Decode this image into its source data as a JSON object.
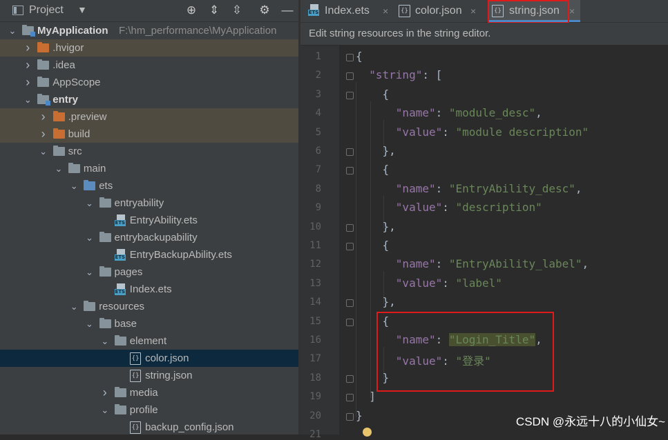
{
  "sidebar": {
    "title": "Project",
    "tree": [
      {
        "label": "MyApplication",
        "path": "F:\\hm_performance\\MyApplication",
        "icon": "module-folder-icon"
      },
      {
        "label": ".hvigor",
        "icon": "excluded-folder-icon"
      },
      {
        "label": ".idea",
        "icon": "folder-icon"
      },
      {
        "label": "AppScope",
        "icon": "folder-icon"
      },
      {
        "label": "entry",
        "icon": "module-folder-icon"
      },
      {
        "label": ".preview",
        "icon": "excluded-folder-icon"
      },
      {
        "label": "build",
        "icon": "excluded-folder-icon"
      },
      {
        "label": "src",
        "icon": "folder-icon"
      },
      {
        "label": "main",
        "icon": "folder-icon"
      },
      {
        "label": "ets",
        "icon": "source-folder-icon"
      },
      {
        "label": "entryability",
        "icon": "folder-icon"
      },
      {
        "label": "EntryAbility.ets",
        "icon": "ets-file-icon"
      },
      {
        "label": "entrybackupability",
        "icon": "folder-icon"
      },
      {
        "label": "EntryBackupAbility.ets",
        "icon": "ets-file-icon"
      },
      {
        "label": "pages",
        "icon": "folder-icon"
      },
      {
        "label": "Index.ets",
        "icon": "ets-file-icon"
      },
      {
        "label": "resources",
        "icon": "folder-icon"
      },
      {
        "label": "base",
        "icon": "folder-icon"
      },
      {
        "label": "element",
        "icon": "folder-icon"
      },
      {
        "label": "color.json",
        "icon": "json-file-icon"
      },
      {
        "label": "string.json",
        "icon": "json-file-icon"
      },
      {
        "label": "media",
        "icon": "folder-icon"
      },
      {
        "label": "profile",
        "icon": "folder-icon"
      },
      {
        "label": "backup_config.json",
        "icon": "json-file-icon"
      }
    ]
  },
  "tabs": [
    {
      "label": "Index.ets",
      "close": "×"
    },
    {
      "label": "color.json",
      "close": "×"
    },
    {
      "label": "string.json",
      "close": "×"
    }
  ],
  "notice": "Edit string resources in the string editor.",
  "editor": {
    "line_numbers": [
      "1",
      "2",
      "3",
      "4",
      "5",
      "6",
      "7",
      "8",
      "9",
      "10",
      "11",
      "12",
      "13",
      "14",
      "15",
      "16",
      "17",
      "18",
      "19",
      "20",
      "21"
    ],
    "lines": [
      {
        "tokens": [
          {
            "t": "{",
            "c": "p"
          }
        ]
      },
      {
        "tokens": [
          {
            "t": "  ",
            "c": "p"
          },
          {
            "t": "\"string\"",
            "c": "k"
          },
          {
            "t": ": [",
            "c": "p"
          }
        ]
      },
      {
        "tokens": [
          {
            "t": "    {",
            "c": "p"
          }
        ]
      },
      {
        "tokens": [
          {
            "t": "      ",
            "c": "p"
          },
          {
            "t": "\"name\"",
            "c": "k"
          },
          {
            "t": ": ",
            "c": "p"
          },
          {
            "t": "\"module_desc\"",
            "c": "s"
          },
          {
            "t": ",",
            "c": "p"
          }
        ]
      },
      {
        "tokens": [
          {
            "t": "      ",
            "c": "p"
          },
          {
            "t": "\"value\"",
            "c": "k"
          },
          {
            "t": ": ",
            "c": "p"
          },
          {
            "t": "\"module description\"",
            "c": "s"
          }
        ]
      },
      {
        "tokens": [
          {
            "t": "    },",
            "c": "p"
          }
        ]
      },
      {
        "tokens": [
          {
            "t": "    {",
            "c": "p"
          }
        ]
      },
      {
        "tokens": [
          {
            "t": "      ",
            "c": "p"
          },
          {
            "t": "\"name\"",
            "c": "k"
          },
          {
            "t": ": ",
            "c": "p"
          },
          {
            "t": "\"EntryAbility_desc\"",
            "c": "s"
          },
          {
            "t": ",",
            "c": "p"
          }
        ]
      },
      {
        "tokens": [
          {
            "t": "      ",
            "c": "p"
          },
          {
            "t": "\"value\"",
            "c": "k"
          },
          {
            "t": ": ",
            "c": "p"
          },
          {
            "t": "\"description\"",
            "c": "s"
          }
        ]
      },
      {
        "tokens": [
          {
            "t": "    },",
            "c": "p"
          }
        ]
      },
      {
        "tokens": [
          {
            "t": "    {",
            "c": "p"
          }
        ]
      },
      {
        "tokens": [
          {
            "t": "      ",
            "c": "p"
          },
          {
            "t": "\"name\"",
            "c": "k"
          },
          {
            "t": ": ",
            "c": "p"
          },
          {
            "t": "\"EntryAbility_label\"",
            "c": "s"
          },
          {
            "t": ",",
            "c": "p"
          }
        ]
      },
      {
        "tokens": [
          {
            "t": "      ",
            "c": "p"
          },
          {
            "t": "\"value\"",
            "c": "k"
          },
          {
            "t": ": ",
            "c": "p"
          },
          {
            "t": "\"label\"",
            "c": "s"
          }
        ]
      },
      {
        "tokens": [
          {
            "t": "    },",
            "c": "p"
          }
        ]
      },
      {
        "tokens": [
          {
            "t": "    {",
            "c": "p"
          }
        ]
      },
      {
        "tokens": [
          {
            "t": "      ",
            "c": "p"
          },
          {
            "t": "\"name\"",
            "c": "k"
          },
          {
            "t": ": ",
            "c": "p"
          },
          {
            "t": "\"Login_Title\"",
            "c": "hl"
          },
          {
            "t": ",",
            "c": "p"
          }
        ]
      },
      {
        "tokens": [
          {
            "t": "      ",
            "c": "p"
          },
          {
            "t": "\"value\"",
            "c": "k"
          },
          {
            "t": ": ",
            "c": "p"
          },
          {
            "t": "\"登录\"",
            "c": "s"
          }
        ]
      },
      {
        "tokens": [
          {
            "t": "    }",
            "c": "p"
          }
        ]
      },
      {
        "tokens": [
          {
            "t": "  ]",
            "c": "p"
          }
        ]
      },
      {
        "tokens": [
          {
            "t": "}",
            "c": "p"
          }
        ]
      },
      {
        "tokens": []
      }
    ]
  },
  "watermark": "CSDN @永远十八的小仙女~",
  "colors": {
    "accent": "#4a88c7",
    "highlight_box": "#e01a1a"
  }
}
